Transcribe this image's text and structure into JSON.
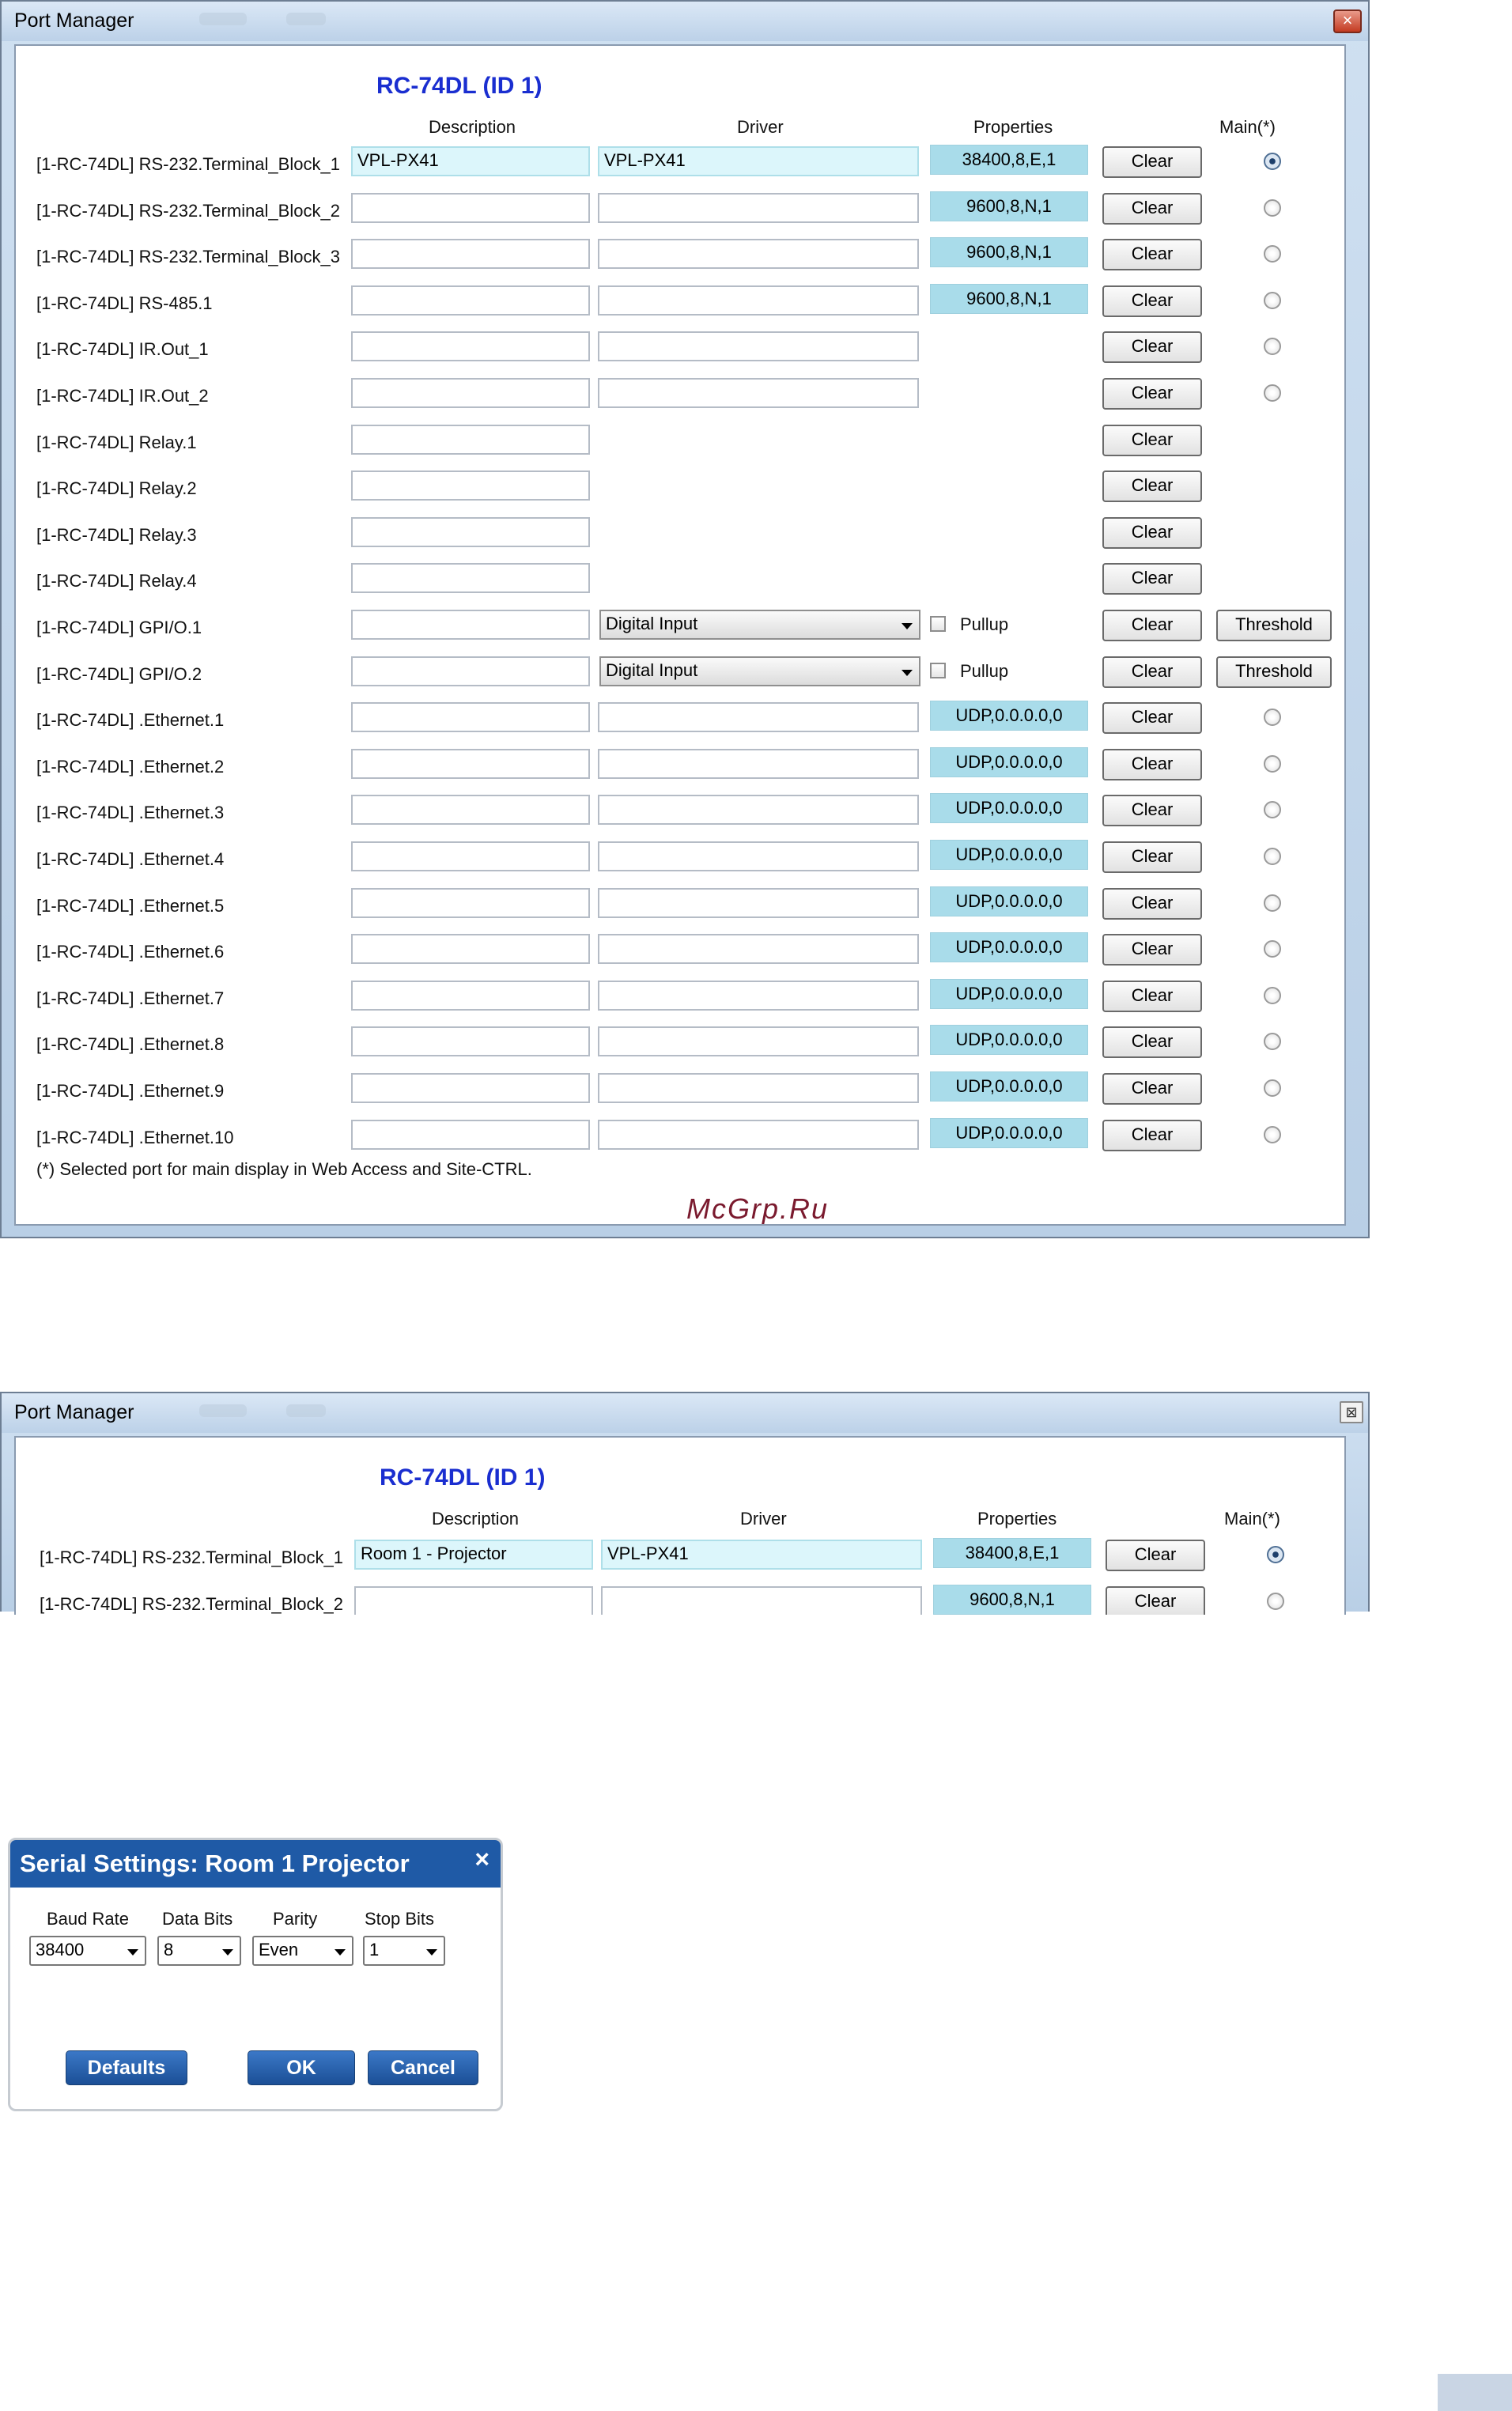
{
  "window1": {
    "title": "Port Manager",
    "device_title": "RC-74DL (ID 1)",
    "headers": {
      "description": "Description",
      "driver": "Driver",
      "properties": "Properties",
      "main": "Main(*)"
    },
    "footnote": "(*) Selected port for main display in Web Access and Site-CTRL.",
    "watermark": "McGrp.Ru",
    "rows": [
      {
        "label": "[1-RC-74DL] RS-232.Terminal_Block_1",
        "description": "VPL-PX41",
        "driver": "VPL-PX41",
        "properties": "38400,8,E,1",
        "clear": "Clear",
        "radio_selected": true
      },
      {
        "label": "[1-RC-74DL] RS-232.Terminal_Block_2",
        "description": "",
        "driver": "",
        "properties": "9600,8,N,1",
        "clear": "Clear"
      },
      {
        "label": "[1-RC-74DL] RS-232.Terminal_Block_3",
        "description": "",
        "driver": "",
        "properties": "9600,8,N,1",
        "clear": "Clear"
      },
      {
        "label": "[1-RC-74DL] RS-485.1",
        "description": "",
        "driver": "",
        "properties": "9600,8,N,1",
        "clear": "Clear"
      },
      {
        "label": "[1-RC-74DL] IR.Out_1",
        "description": "",
        "driver": "",
        "clear": "Clear"
      },
      {
        "label": "[1-RC-74DL] IR.Out_2",
        "description": "",
        "driver": "",
        "clear": "Clear"
      },
      {
        "label": "[1-RC-74DL] Relay.1",
        "description": "",
        "clear": "Clear"
      },
      {
        "label": "[1-RC-74DL] Relay.2",
        "description": "",
        "clear": "Clear"
      },
      {
        "label": "[1-RC-74DL] Relay.3",
        "description": "",
        "clear": "Clear"
      },
      {
        "label": "[1-RC-74DL] Relay.4",
        "description": "",
        "clear": "Clear"
      },
      {
        "label": "[1-RC-74DL] GPI/O.1",
        "description": "",
        "combo": "Digital Input",
        "pullup": "Pullup",
        "clear": "Clear",
        "threshold": "Threshold"
      },
      {
        "label": "[1-RC-74DL] GPI/O.2",
        "description": "",
        "combo": "Digital Input",
        "pullup": "Pullup",
        "clear": "Clear",
        "threshold": "Threshold"
      },
      {
        "label": "[1-RC-74DL] .Ethernet.1",
        "description": "",
        "driver": "",
        "properties": "UDP,0.0.0.0,0",
        "clear": "Clear"
      },
      {
        "label": "[1-RC-74DL] .Ethernet.2",
        "description": "",
        "driver": "",
        "properties": "UDP,0.0.0.0,0",
        "clear": "Clear"
      },
      {
        "label": "[1-RC-74DL] .Ethernet.3",
        "description": "",
        "driver": "",
        "properties": "UDP,0.0.0.0,0",
        "clear": "Clear"
      },
      {
        "label": "[1-RC-74DL] .Ethernet.4",
        "description": "",
        "driver": "",
        "properties": "UDP,0.0.0.0,0",
        "clear": "Clear"
      },
      {
        "label": "[1-RC-74DL] .Ethernet.5",
        "description": "",
        "driver": "",
        "properties": "UDP,0.0.0.0,0",
        "clear": "Clear"
      },
      {
        "label": "[1-RC-74DL] .Ethernet.6",
        "description": "",
        "driver": "",
        "properties": "UDP,0.0.0.0,0",
        "clear": "Clear"
      },
      {
        "label": "[1-RC-74DL] .Ethernet.7",
        "description": "",
        "driver": "",
        "properties": "UDP,0.0.0.0,0",
        "clear": "Clear"
      },
      {
        "label": "[1-RC-74DL] .Ethernet.8",
        "description": "",
        "driver": "",
        "properties": "UDP,0.0.0.0,0",
        "clear": "Clear"
      },
      {
        "label": "[1-RC-74DL] .Ethernet.9",
        "description": "",
        "driver": "",
        "properties": "UDP,0.0.0.0,0",
        "clear": "Clear"
      },
      {
        "label": "[1-RC-74DL] .Ethernet.10",
        "description": "",
        "driver": "",
        "properties": "UDP,0.0.0.0,0",
        "clear": "Clear"
      }
    ]
  },
  "window2": {
    "title": "Port Manager",
    "device_title": "RC-74DL (ID 1)",
    "headers": {
      "description": "Description",
      "driver": "Driver",
      "properties": "Properties",
      "main": "Main(*)"
    },
    "rows": [
      {
        "label": "[1-RC-74DL] RS-232.Terminal_Block_1",
        "description": "Room 1 - Projector",
        "driver": "VPL-PX41",
        "properties": "38400,8,E,1",
        "clear": "Clear",
        "radio_selected": true
      },
      {
        "label": "[1-RC-74DL] RS-232.Terminal_Block_2",
        "description": "",
        "driver": "",
        "properties": "9600,8,N,1",
        "clear": "Clear"
      }
    ]
  },
  "serial_dialog": {
    "title": "Serial Settings: Room 1 Projector",
    "close": "×",
    "fields": [
      {
        "label": "Baud Rate",
        "value": "38400"
      },
      {
        "label": "Data Bits",
        "value": "8"
      },
      {
        "label": "Parity",
        "value": "Even"
      },
      {
        "label": "Stop Bits",
        "value": "1"
      }
    ],
    "buttons": {
      "defaults": "Defaults",
      "ok": "OK",
      "cancel": "Cancel"
    }
  }
}
